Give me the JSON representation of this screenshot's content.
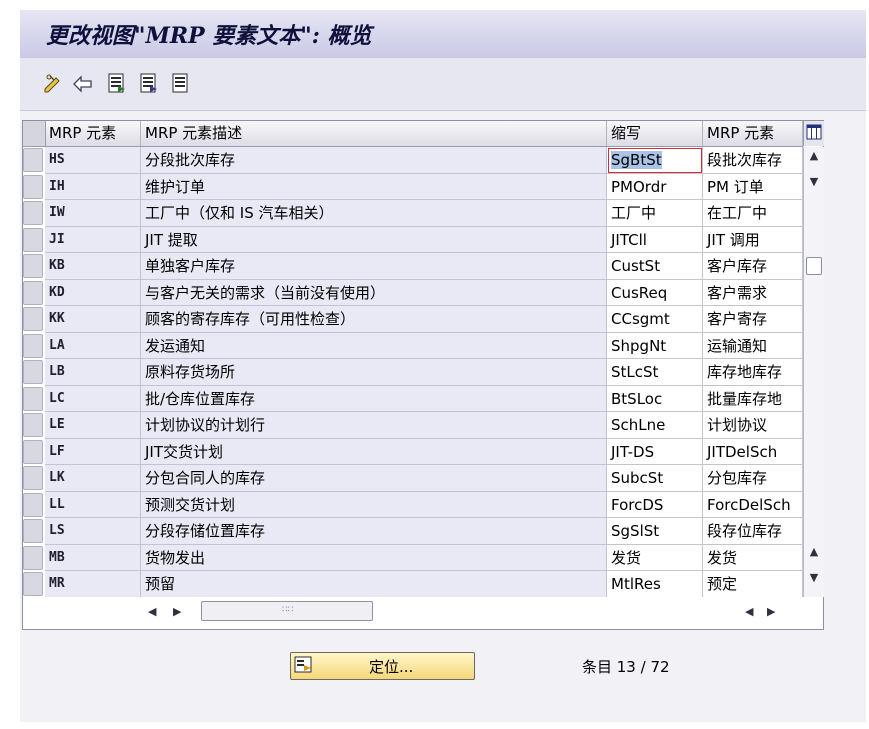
{
  "window": {
    "title": "更改视图\"MRP 要素文本\": 概览"
  },
  "toolbar": {
    "buttons": [
      {
        "icon": "display-change-icon"
      },
      {
        "icon": "other-view-icon"
      },
      {
        "icon": "select-all-icon"
      },
      {
        "icon": "select-block-icon"
      },
      {
        "icon": "deselect-all-icon"
      }
    ]
  },
  "table": {
    "columns": [
      "MRP 元素",
      "MRP 元素描述",
      "缩写",
      "MRP 元素"
    ],
    "rows": [
      {
        "code": "HS",
        "desc": "分段批次库存",
        "abbr": "SgBtSt",
        "elem": "段批次库存"
      },
      {
        "code": "IH",
        "desc": "维护订单",
        "abbr": "PMOrdr",
        "elem": "PM 订单"
      },
      {
        "code": "IW",
        "desc": "工厂中（仅和 IS 汽车相关）",
        "abbr": "工厂中",
        "elem": "在工厂中"
      },
      {
        "code": "JI",
        "desc": "JIT 提取",
        "abbr": "JITCll",
        "elem": "JIT 调用"
      },
      {
        "code": "KB",
        "desc": "单独客户库存",
        "abbr": "CustSt",
        "elem": "客户库存"
      },
      {
        "code": "KD",
        "desc": "与客户无关的需求（当前没有使用）",
        "abbr": "CusReq",
        "elem": "客户需求"
      },
      {
        "code": "KK",
        "desc": "顾客的寄存库存（可用性检查）",
        "abbr": "CCsgmt",
        "elem": "客户寄存"
      },
      {
        "code": "LA",
        "desc": "发运通知",
        "abbr": "ShpgNt",
        "elem": "运输通知"
      },
      {
        "code": "LB",
        "desc": "原料存货场所",
        "abbr": "StLcSt",
        "elem": "库存地库存"
      },
      {
        "code": "LC",
        "desc": "批/仓库位置库存",
        "abbr": "BtSLoc",
        "elem": "批量库存地"
      },
      {
        "code": "LE",
        "desc": "计划协议的计划行",
        "abbr": "SchLne",
        "elem": "计划协议"
      },
      {
        "code": "LF",
        "desc": "JIT交货计划",
        "abbr": "JIT-DS",
        "elem": "JITDelSch"
      },
      {
        "code": "LK",
        "desc": "分包合同人的库存",
        "abbr": "SubcSt",
        "elem": "分包库存"
      },
      {
        "code": "LL",
        "desc": "预测交货计划",
        "abbr": "ForcDS",
        "elem": "ForcDelSch"
      },
      {
        "code": "LS",
        "desc": "分段存储位置库存",
        "abbr": "SgSlSt",
        "elem": "段存位库存"
      },
      {
        "code": "MB",
        "desc": "货物发出",
        "abbr": "发货",
        "elem": "发货"
      },
      {
        "code": "MR",
        "desc": "预留",
        "abbr": "MtlRes",
        "elem": "预定"
      }
    ]
  },
  "footer": {
    "position_button": "定位...",
    "entry_status": "条目 13 / 72"
  }
}
